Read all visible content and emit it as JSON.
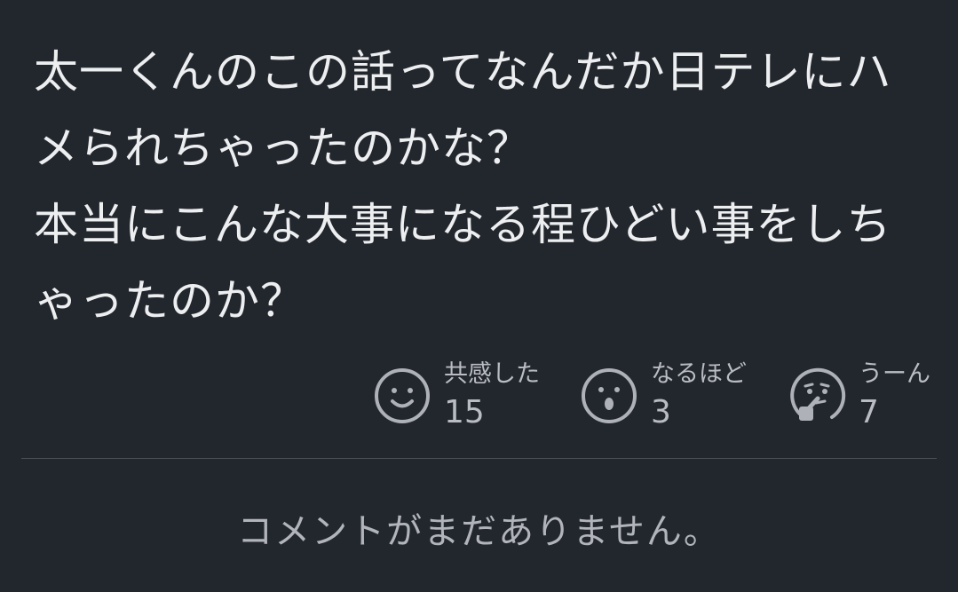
{
  "comment": {
    "text": "太一くんのこの話ってなんだか日テレにハメられちゃったのかな？\n本当にこんな大事になる程ひどい事をしちゃったのか？"
  },
  "reactions": [
    {
      "label": "共感した",
      "count": "15",
      "icon": "smile-face-icon"
    },
    {
      "label": "なるほど",
      "count": "3",
      "icon": "surprised-face-icon"
    },
    {
      "label": "うーん",
      "count": "7",
      "icon": "thinking-face-icon"
    }
  ],
  "comments_section": {
    "empty_message": "コメントがまだありません。"
  },
  "colors": {
    "background": "#22262d",
    "text_primary": "#eceef0",
    "text_secondary": "#b9bcc2",
    "icon": "#aeb2b8",
    "divider": "#4a4e56"
  }
}
